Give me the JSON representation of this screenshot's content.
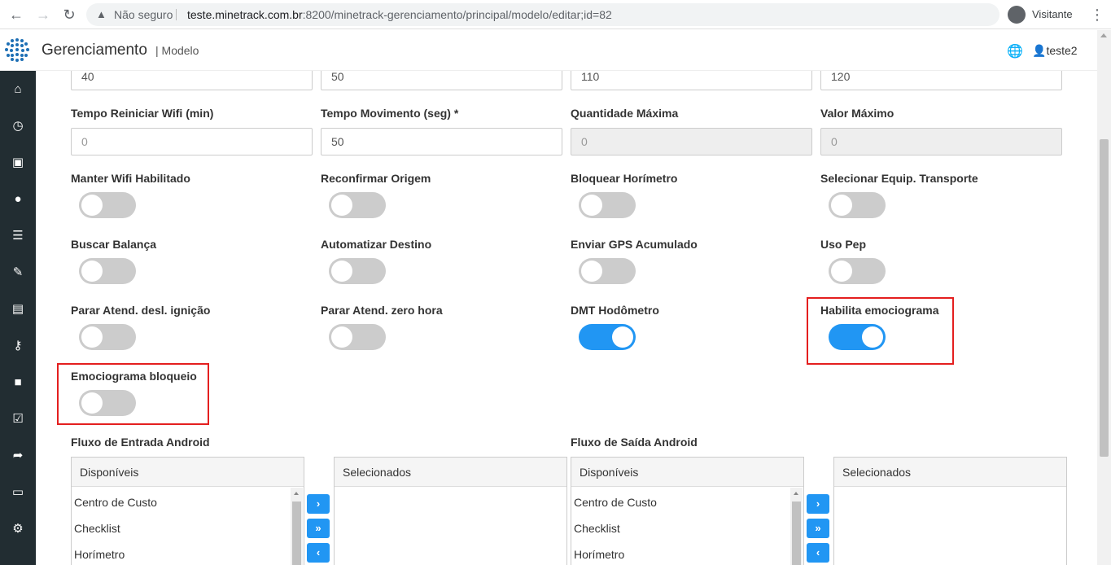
{
  "browser": {
    "secure_label": "Não seguro",
    "url_host": "teste.minetrack.com.br",
    "url_rest": ":8200/minetrack-gerenciamento/principal/modelo/editar;id=82",
    "profile_name": "Visitante"
  },
  "header": {
    "title": "Gerenciamento",
    "subtitle": "| Modelo",
    "user": "teste2"
  },
  "sidebar": {
    "items": [
      "home-icon",
      "clock-icon",
      "bus-icon",
      "user-icon",
      "bars-icon",
      "wrench-icon",
      "archive-icon",
      "key-icon",
      "lock-icon",
      "check-square-icon",
      "share-icon",
      "money-icon",
      "cogs-icon"
    ]
  },
  "top_inputs": [
    "40",
    "50",
    "110",
    "120"
  ],
  "fields": [
    {
      "label": "Tempo Reiniciar Wifi (min)",
      "value": "0"
    },
    {
      "label": "Tempo Movimento (seg) *",
      "value": "50"
    },
    {
      "label": "Quantidade Máxima",
      "value": "0"
    },
    {
      "label": "Valor Máximo",
      "value": "0"
    }
  ],
  "toggles": [
    {
      "label": "Manter Wifi Habilitado",
      "on": false
    },
    {
      "label": "Reconfirmar Origem",
      "on": false
    },
    {
      "label": "Bloquear Horímetro",
      "on": false
    },
    {
      "label": "Selecionar Equip. Transporte",
      "on": false
    },
    {
      "label": "Buscar Balança",
      "on": false
    },
    {
      "label": "Automatizar Destino",
      "on": false
    },
    {
      "label": "Enviar GPS Acumulado",
      "on": false
    },
    {
      "label": "Uso Pep",
      "on": false
    },
    {
      "label": "Parar Atend. desl. ignição",
      "on": false
    },
    {
      "label": "Parar Atend. zero hora",
      "on": false
    },
    {
      "label": "DMT Hodômetro",
      "on": true
    },
    {
      "label": "Habilita emociograma",
      "on": true
    },
    {
      "label": "Emociograma bloqueio",
      "on": false
    }
  ],
  "flows": {
    "entrada": {
      "title": "Fluxo de Entrada Android",
      "available_header": "Disponíveis",
      "selected_header": "Selecionados",
      "items": [
        "Centro de Custo",
        "Checklist",
        "Horímetro"
      ]
    },
    "saida": {
      "title": "Fluxo de Saída Android",
      "available_header": "Disponíveis",
      "selected_header": "Selecionados",
      "items": [
        "Centro de Custo",
        "Checklist",
        "Horímetro"
      ]
    },
    "buttons": {
      "move_one": "›",
      "move_all": "»",
      "move_back": "‹"
    }
  },
  "colors": {
    "toggle_on": "#2196f3",
    "highlight": "#e41f1f",
    "sidebar": "#222d32"
  }
}
